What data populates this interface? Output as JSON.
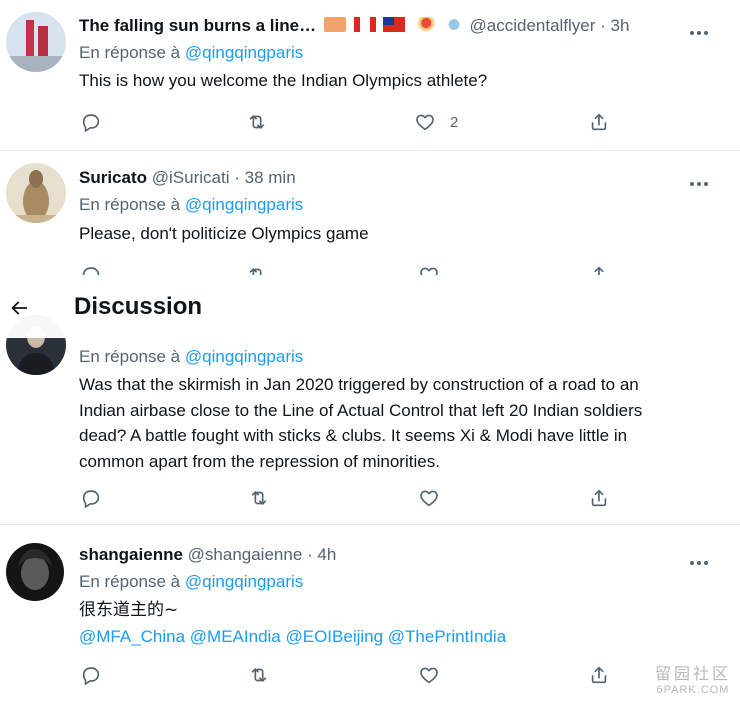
{
  "tweets": [
    {
      "name": "The falling sun burns a line…",
      "handle": "@accidentalflyer",
      "time": "· 3h",
      "reply_prefix": "En réponse à",
      "reply_to": "@qingqingparis",
      "text": "This is how you welcome the Indian Olympics athlete?",
      "like_count": "2"
    },
    {
      "name": "Suricato",
      "handle": "@iSuricati",
      "time": "· 38 min",
      "reply_prefix": "En réponse à",
      "reply_to": "@qingqingparis",
      "text": "Please, don't politicize Olympics game"
    },
    {
      "reply_prefix": "En réponse à",
      "reply_to": "@qingqingparis",
      "text_lines": [
        "Was that the skirmish in Jan 2020 triggered by construction of a road to an",
        "Indian airbase close to the Line of Actual Control that left 20 Indian soldiers",
        "dead? A battle fought with sticks & clubs. It seems Xi & Modi have little in",
        "common apart from the repression of minorities."
      ]
    },
    {
      "name": "shangaienne",
      "handle": "@shangaienne",
      "time": "· 4h",
      "reply_prefix": "En réponse à",
      "reply_to": "@qingqingparis",
      "text": "很东道主的~",
      "mentions": "@MFA_China @MEAIndia @EOIBeijing @ThePrintIndia"
    }
  ],
  "discussion_header": {
    "title": "Discussion",
    "back_icon": "arrow-left-icon"
  },
  "watermark": {
    "line1": "留园社区",
    "line2": "6PARK.COM"
  },
  "colors": {
    "accent": "#1d9bf0",
    "secondary_text": "#536471",
    "primary_text": "#0f1419"
  }
}
